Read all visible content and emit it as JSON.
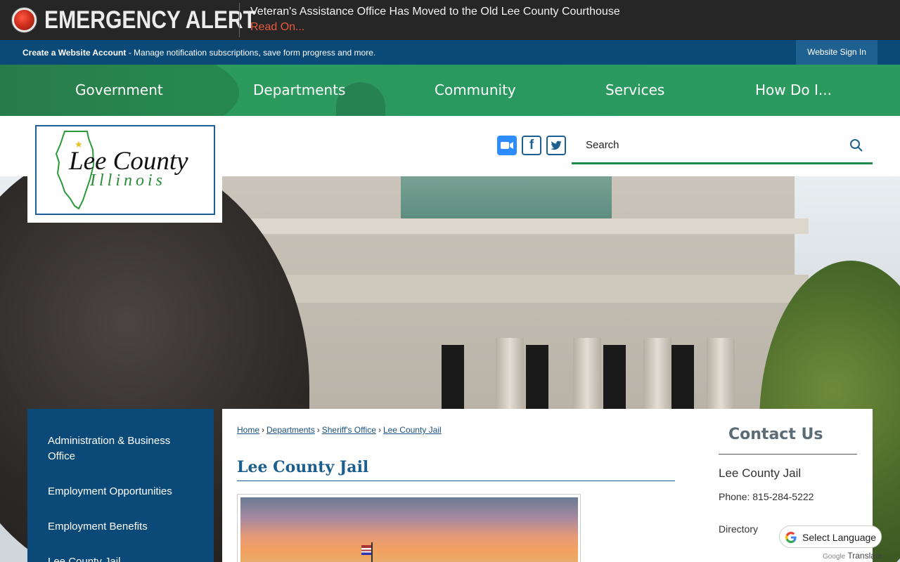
{
  "alert": {
    "title": "EMERGENCY ALERT",
    "message": "Veteran's Assistance Office Has Moved to the Old Lee County Courthouse",
    "read_on": "Read On..."
  },
  "account_bar": {
    "create_label": "Create a Website Account",
    "create_desc": " - Manage notification subscriptions, save form progress and more.",
    "signin": "Website Sign In"
  },
  "nav": {
    "items": [
      "Government",
      "Departments",
      "Community",
      "Services",
      "How Do I..."
    ]
  },
  "logo": {
    "line1": "Lee County",
    "line2": "Illinois"
  },
  "social": {
    "zoom": "zoom-icon",
    "facebook": "f",
    "twitter": "twitter-icon"
  },
  "search": {
    "placeholder": "Search"
  },
  "sidebar": {
    "items": [
      "Administration & Business Office",
      "Employment Opportunities",
      "Employment Benefits",
      "Lee County Jail"
    ]
  },
  "breadcrumb": [
    "Home",
    "Departments",
    "Sheriff's Office",
    "Lee County Jail"
  ],
  "page": {
    "title": "Lee County Jail"
  },
  "contact": {
    "title": "Contact Us",
    "name": "Lee County Jail",
    "phone": "Phone: 815-284-5222",
    "directory": "Directory"
  },
  "translate": {
    "label": "Select Language",
    "powered_google": "Google",
    "powered_translate": "Translate"
  },
  "colors": {
    "alert_bg": "#262626",
    "account_bg": "#0b4a78",
    "nav_bg": "#2a9960",
    "title_blue": "#1b5e8e",
    "read_on_red": "#e85a3c"
  }
}
